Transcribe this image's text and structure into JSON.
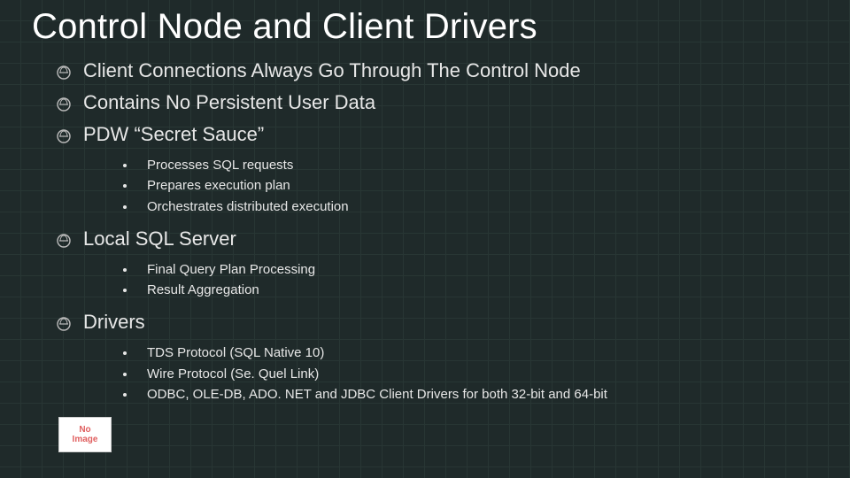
{
  "title": "Control Node and Client Drivers",
  "bullets": [
    {
      "label": "Client Connections Always Go Through The Control Node",
      "sub": []
    },
    {
      "label": "Contains No Persistent User Data",
      "sub": []
    },
    {
      "label": "PDW “Secret Sauce”",
      "sub": [
        "Processes SQL requests",
        "Prepares execution plan",
        "Orchestrates distributed execution"
      ]
    },
    {
      "label": "Local SQL Server",
      "sub": [
        "Final Query Plan Processing",
        "Result Aggregation"
      ]
    },
    {
      "label": "Drivers",
      "sub": [
        "TDS Protocol (SQL Native 10)",
        "Wire Protocol (Se. Quel Link)",
        "ODBC, OLE-DB, ADO. NET and JDBC Client Drivers for both 32-bit and 64-bit"
      ]
    }
  ],
  "placeholder_line1": "No",
  "placeholder_line2": "Image"
}
